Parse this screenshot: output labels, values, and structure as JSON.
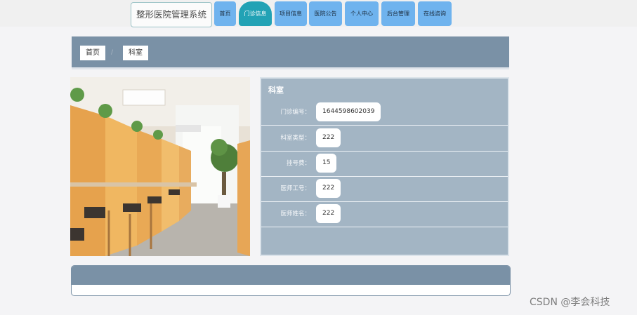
{
  "header": {
    "brand": "整形医院管理系统",
    "nav": [
      {
        "label": "首页"
      },
      {
        "label": "门诊信息",
        "active": true
      },
      {
        "label": "项目信息"
      },
      {
        "label": "医院公告"
      },
      {
        "label": "个人中心"
      },
      {
        "label": "后台管理"
      },
      {
        "label": "在线咨询"
      }
    ]
  },
  "breadcrumb": {
    "home": "首页",
    "separator": "/",
    "current": "科室"
  },
  "detail": {
    "title": "科室",
    "fields": [
      {
        "label": "门诊编号：",
        "value": "1644598602039"
      },
      {
        "label": "科室类型：",
        "value": "222"
      },
      {
        "label": "挂号费：",
        "value": "15"
      },
      {
        "label": "医师工号：",
        "value": "222"
      },
      {
        "label": "医师姓名：",
        "value": "222"
      }
    ]
  },
  "watermark": "CSDN @李会科技",
  "colors": {
    "nav": "#6fb3ee",
    "nav_active": "#22a2b5",
    "panel": "#a3b5c4",
    "banner": "#7a91a6"
  }
}
